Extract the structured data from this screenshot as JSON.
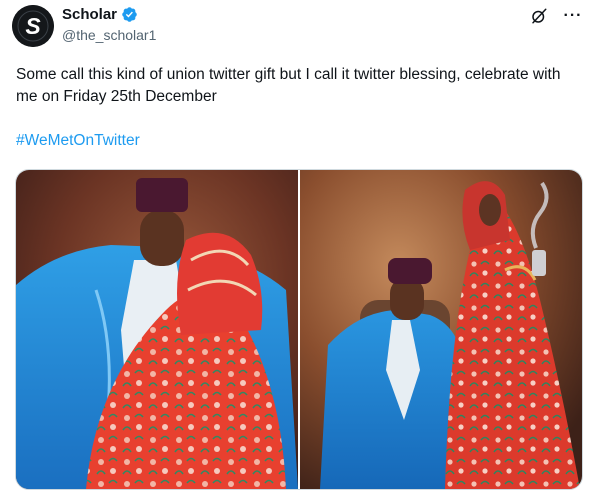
{
  "author": {
    "name": "Scholar",
    "handle": "@the_scholar1",
    "avatar_letter": "S",
    "verified_icon": "verified-badge-icon",
    "verified_color": "#1d9bf0"
  },
  "header_icons": {
    "grok": "grok-icon",
    "more": "more-icon",
    "more_glyph": "···"
  },
  "tweet": {
    "text": "Some call this kind of union twitter gift but I call it twitter blessing, celebrate with me on Friday 25th December",
    "hashtag": "#WeMetOnTwitter",
    "hashtag_color": "#1d9bf0"
  },
  "colors": {
    "text": "#0f1419",
    "secondary_text": "#536471",
    "border": "#cfd9de"
  }
}
